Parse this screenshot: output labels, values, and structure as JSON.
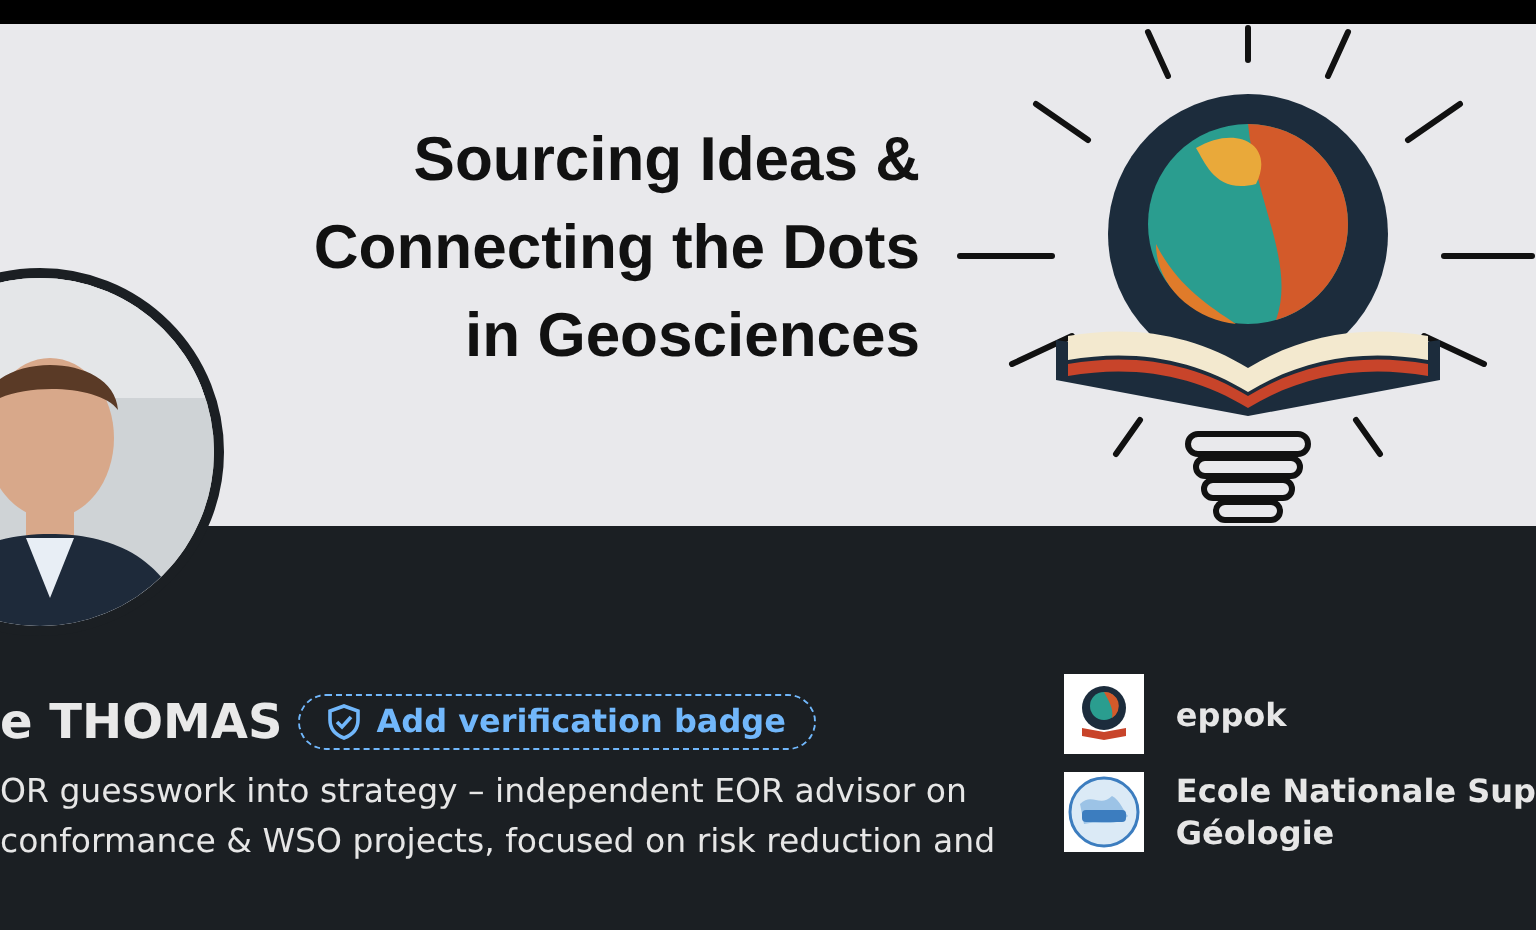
{
  "banner": {
    "title_lines": [
      "Sourcing Ideas &",
      "Connecting the Dots",
      "in Geosciences"
    ]
  },
  "profile": {
    "name": "e THOMAS",
    "verification_button": "Add verification badge",
    "headline_lines": [
      "OR guesswork into strategy – independent EOR advisor on",
      "conformance & WSO projects, focused on risk reduction and"
    ]
  },
  "organizations": [
    {
      "kind": "company",
      "name_lines": [
        "eppok"
      ]
    },
    {
      "kind": "school",
      "name_lines": [
        "Ecole Nationale Sup",
        "Géologie"
      ]
    }
  ]
}
